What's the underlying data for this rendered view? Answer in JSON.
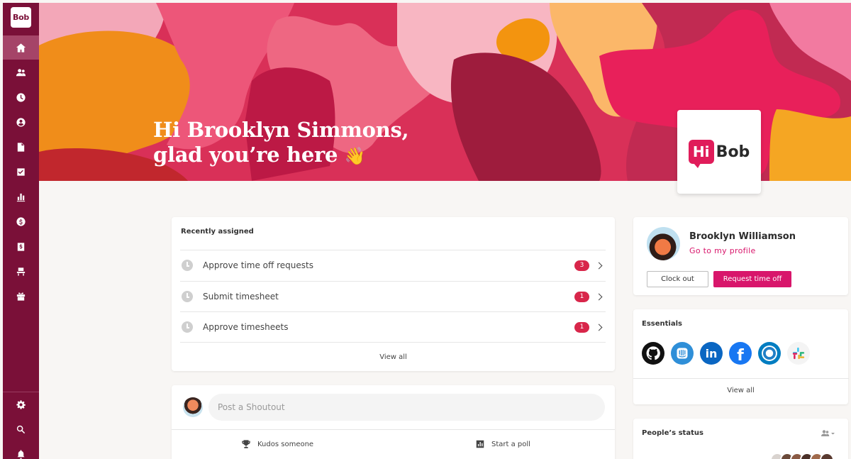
{
  "sidebar": {
    "logo": "Bob",
    "items": [
      {
        "name": "home-icon"
      },
      {
        "name": "people-icon"
      },
      {
        "name": "time-icon"
      },
      {
        "name": "profile-icon"
      },
      {
        "name": "documents-icon"
      },
      {
        "name": "tasks-icon"
      },
      {
        "name": "analytics-icon"
      },
      {
        "name": "payroll-icon"
      },
      {
        "name": "compensation-icon"
      },
      {
        "name": "workspace-icon"
      },
      {
        "name": "perks-icon"
      }
    ],
    "bottom_items": [
      {
        "name": "settings-icon"
      },
      {
        "name": "search-icon"
      },
      {
        "name": "notifications-icon"
      }
    ]
  },
  "banner": {
    "greeting_line1": "Hi Brooklyn Simmons,",
    "greeting_line2": "glad you’re here",
    "emoji": "👋",
    "logo_hi": "Hi",
    "logo_bob": "Bob"
  },
  "recently_assigned": {
    "title": "Recently assigned",
    "tasks": [
      {
        "label": "Approve time off requests",
        "count": "3"
      },
      {
        "label": "Submit timesheet",
        "count": "1"
      },
      {
        "label": "Approve timesheets",
        "count": "1"
      }
    ],
    "view_all": "View all"
  },
  "shoutout": {
    "placeholder": "Post a Shoutout",
    "kudos_label": "Kudos someone",
    "poll_label": "Start a poll"
  },
  "profile": {
    "name": "Brooklyn Williamson",
    "link": "Go to my profile",
    "clock_out": "Clock out",
    "request_time_off": "Request time off"
  },
  "essentials": {
    "title": "Essentials",
    "apps": [
      {
        "name": "github-icon",
        "color": "#111111"
      },
      {
        "name": "intercom-icon",
        "color": "#2f8fd8"
      },
      {
        "name": "linkedin-icon",
        "color": "#0a66c2"
      },
      {
        "name": "facebook-icon",
        "color": "#1877f2"
      },
      {
        "name": "okta-icon",
        "color": "#007dc1"
      },
      {
        "name": "slack-icon",
        "color": "#4a154b"
      }
    ],
    "linkedin_text": "in",
    "facebook_text": "f",
    "view_all": "View all"
  },
  "peoples_status": {
    "title": "People’s status"
  },
  "colors": {
    "sidebar": "#7a1038",
    "accent": "#d8166b",
    "badge": "#d8264a"
  }
}
